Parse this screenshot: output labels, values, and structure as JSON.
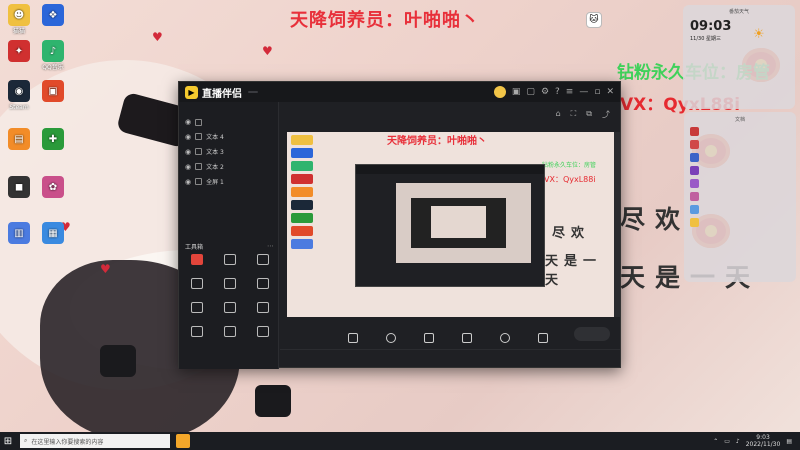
{
  "overlay": {
    "title": "天降饲养员：叶啪啪丶",
    "green_line": "钻粉永久车位：房管",
    "vx_line": "VX：QyxL88i",
    "big_line1": "尽欢",
    "big_line2": "天是一天"
  },
  "desktop_icons": [
    {
      "label": "猫猫",
      "color": "#f0c040",
      "glyph": "☻"
    },
    {
      "label": "",
      "color": "#2b66d9",
      "glyph": "❖"
    },
    {
      "label": "",
      "color": "#d03030",
      "glyph": "✦"
    },
    {
      "label": "QQ音乐",
      "color": "#2fb46e",
      "glyph": "♪"
    },
    {
      "label": "Steam",
      "color": "#1b2838",
      "glyph": "◉"
    },
    {
      "label": "",
      "color": "#e14a2a",
      "glyph": "▣"
    },
    {
      "label": "",
      "color": "#f28c28",
      "glyph": "▤"
    },
    {
      "label": "",
      "color": "#2a9a3a",
      "glyph": "✚"
    },
    {
      "label": "",
      "color": "#333",
      "glyph": "◼"
    },
    {
      "label": "",
      "color": "#c94f8a",
      "glyph": "✿"
    },
    {
      "label": "",
      "color": "#4b7be0",
      "glyph": "▥"
    },
    {
      "label": "",
      "color": "#3a8ae0",
      "glyph": "▦"
    }
  ],
  "clock_widget": {
    "header": "番茄天气",
    "time": "09:03",
    "date": "11/30 星期三",
    "temp": "",
    "tip": ""
  },
  "files_widget": {
    "header": "文档",
    "rows": [
      {
        "label": "",
        "color": "#c83a3a"
      },
      {
        "label": "",
        "color": "#d04848"
      },
      {
        "label": "",
        "color": "#3b63c8"
      },
      {
        "label": "",
        "color": "#7b3fb8"
      },
      {
        "label": "",
        "color": "#9a59c7"
      },
      {
        "label": "",
        "color": "#c060a0"
      },
      {
        "label": "",
        "color": "#5a9ae0"
      },
      {
        "label": "",
        "color": "#f0c040"
      }
    ]
  },
  "app": {
    "name": "直播伴侣",
    "badge": "",
    "tabs": [
      "",
      "",
      ""
    ],
    "layers": [
      {
        "label": ""
      },
      {
        "label": "文本 4"
      },
      {
        "label": "文本 3"
      },
      {
        "label": "文本 2"
      },
      {
        "label": "全屏 1"
      }
    ],
    "tools_header": "工具箱",
    "tools": [
      {
        "label": ""
      },
      {
        "label": ""
      },
      {
        "label": ""
      },
      {
        "label": ""
      },
      {
        "label": ""
      },
      {
        "label": ""
      },
      {
        "label": ""
      },
      {
        "label": ""
      },
      {
        "label": ""
      },
      {
        "label": ""
      },
      {
        "label": ""
      },
      {
        "label": ""
      }
    ],
    "footer_note": "",
    "info_line": "",
    "info_tag": "",
    "info_sub": [
      "",
      "",
      "",
      ""
    ],
    "bottom_buttons": [
      "",
      "",
      "",
      "",
      "",
      ""
    ],
    "start_label": "",
    "status": [
      "",
      "",
      "",
      ""
    ]
  },
  "taskbar": {
    "search_placeholder": "在这里输入你要搜索的内容",
    "time": "9:03",
    "date": "2022/11/30"
  }
}
